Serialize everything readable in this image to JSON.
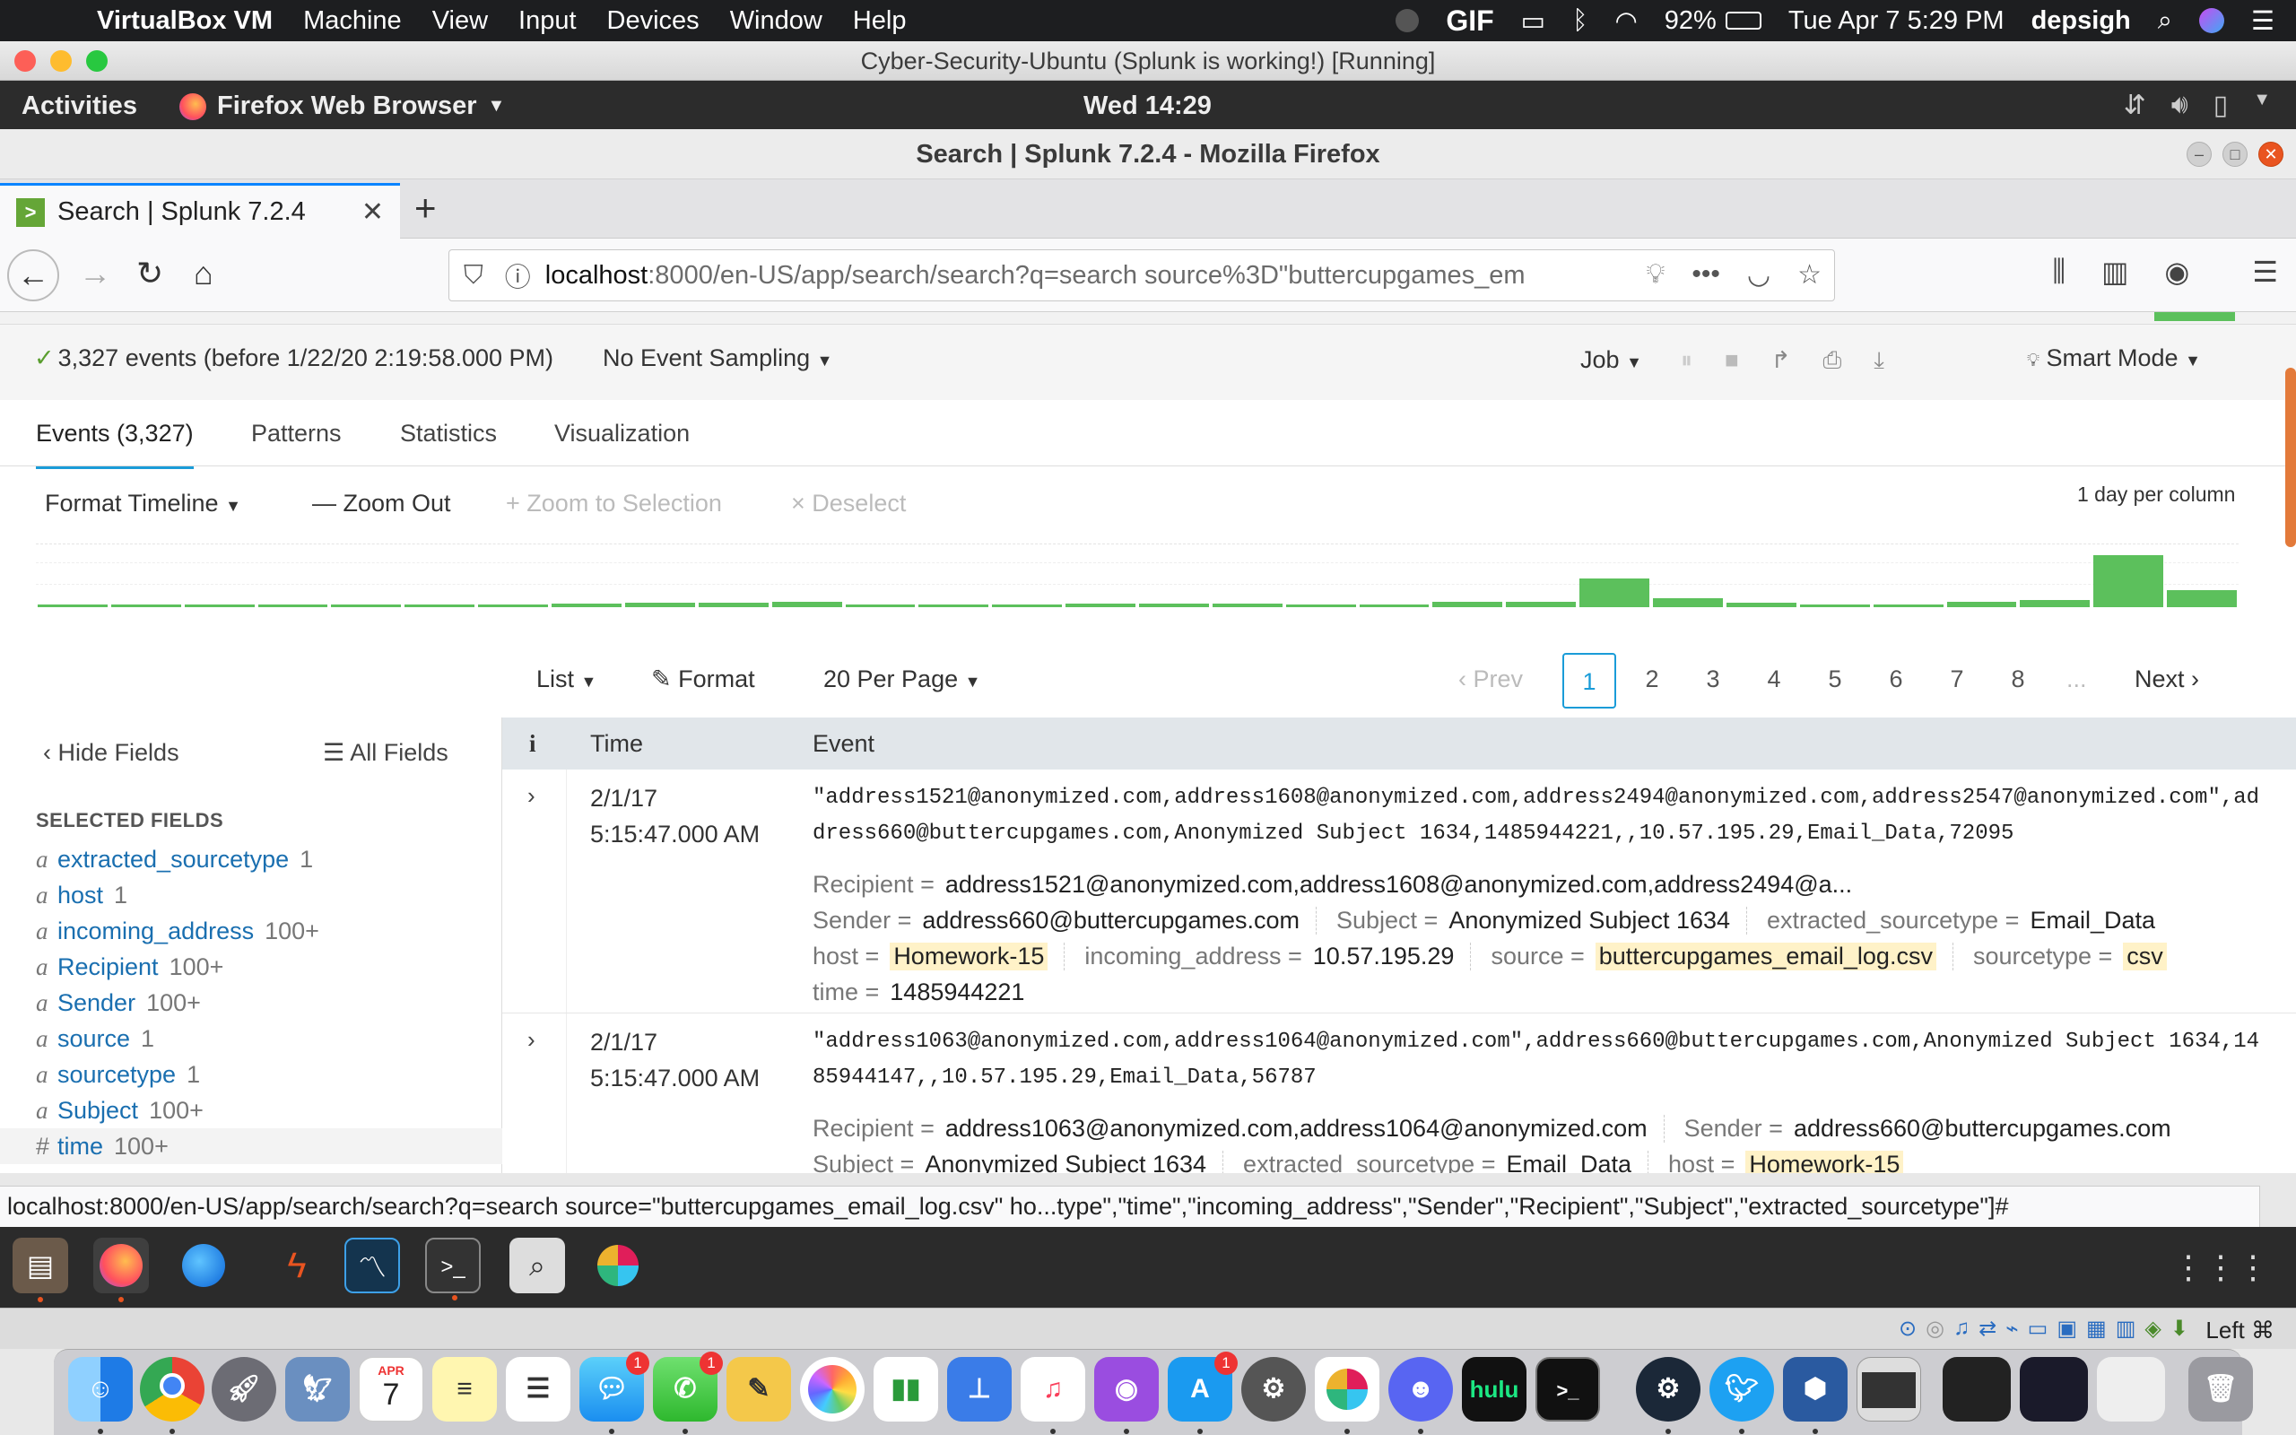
{
  "mac_menubar": {
    "app_name": "VirtualBox VM",
    "menus": [
      "Machine",
      "View",
      "Input",
      "Devices",
      "Window",
      "Help"
    ],
    "status": {
      "gif": "GIF",
      "battery": "92%",
      "datetime": "Tue Apr 7  5:29 PM",
      "user": "depsigh"
    }
  },
  "vbox_window": {
    "title": "Cyber-Security-Ubuntu (Splunk is working!) [Running]"
  },
  "ubuntu_topbar": {
    "activities": "Activities",
    "app": "Firefox Web Browser",
    "clock": "Wed 14:29"
  },
  "firefox": {
    "window_title": "Search | Splunk 7.2.4 - Mozilla Firefox",
    "tab_title": "Search | Splunk 7.2.4",
    "url_host": "localhost",
    "url_path": ":8000/en-US/app/search/search?q=search source%3D\"buttercupgames_em",
    "status_url": "localhost:8000/en-US/app/search/search?q=search source=\"buttercupgames_email_log.csv\" ho...type\",\"time\",\"incoming_address\",\"Sender\",\"Recipient\",\"Subject\",\"extracted_sourcetype\"]#"
  },
  "splunk": {
    "events_summary": "3,327 events (before 1/22/20 2:19:58.000 PM)",
    "sampling": "No Event Sampling",
    "job": "Job",
    "mode": "Smart Mode",
    "tabs": [
      "Events (3,327)",
      "Patterns",
      "Statistics",
      "Visualization"
    ],
    "timeline_controls": {
      "format": "Format Timeline",
      "zoom_out": "Zoom Out",
      "zoom_selection": "Zoom to Selection",
      "deselect": "Deselect",
      "scale": "1 day per column"
    },
    "timeline_counts": [
      0.02,
      0.05,
      0.05,
      0.05,
      0.05,
      0.05,
      0.05,
      0.06,
      0.08,
      0.08,
      0.1,
      0.05,
      0.05,
      0.05,
      0.07,
      0.07,
      0.07,
      0.05,
      0.04,
      0.1,
      0.1,
      0.5,
      0.15,
      0.08,
      0.05,
      0.05,
      0.1,
      0.12,
      0.9,
      0.3
    ],
    "list_options": {
      "list": "List",
      "format": "Format",
      "per_page": "20 Per Page"
    },
    "pagination": {
      "prev": "Prev",
      "pages": [
        "1",
        "2",
        "3",
        "4",
        "5",
        "6",
        "7",
        "8"
      ],
      "current": "1",
      "ellipsis": "...",
      "next": "Next"
    },
    "sidebar": {
      "hide_fields": "Hide Fields",
      "all_fields": "All Fields",
      "selected_heading": "SELECTED FIELDS",
      "fields": [
        {
          "type": "a",
          "name": "extracted_sourcetype",
          "count": "1"
        },
        {
          "type": "a",
          "name": "host",
          "count": "1"
        },
        {
          "type": "a",
          "name": "incoming_address",
          "count": "100+"
        },
        {
          "type": "a",
          "name": "Recipient",
          "count": "100+"
        },
        {
          "type": "a",
          "name": "Sender",
          "count": "100+"
        },
        {
          "type": "a",
          "name": "source",
          "count": "1"
        },
        {
          "type": "a",
          "name": "sourcetype",
          "count": "1"
        },
        {
          "type": "a",
          "name": "Subject",
          "count": "100+"
        },
        {
          "type": "#",
          "name": "time",
          "count": "100+"
        }
      ]
    },
    "table_headers": {
      "info": "i",
      "time": "Time",
      "event": "Event"
    },
    "events": [
      {
        "date": "2/1/17",
        "time": "5:15:47.000 AM",
        "raw": "\"address1521@anonymized.com,address1608@anonymized.com,address2494@anonymized.com,address2547@anonymized.com\",address660@buttercupgames.com,Anonymized Subject 1634,1485944221,,10.57.195.29,Email_Data,72095",
        "line1_k0": "Recipient =",
        "line1_v0": "address1521@anonymized.com,address1608@anonymized.com,address2494@a...",
        "line2_k0": "Sender =",
        "line2_v0": "address660@buttercupgames.com",
        "line2_k1": "Subject =",
        "line2_v1": "Anonymized Subject 1634",
        "line2_k2": "extracted_sourcetype =",
        "line2_v2": "Email_Data",
        "line3_k0": "host =",
        "line3_v0": "Homework-15",
        "line3_k1": "incoming_address =",
        "line3_v1": "10.57.195.29",
        "line3_k2": "source =",
        "line3_v2": "buttercupgames_email_log.csv",
        "line3_k3": "sourcetype =",
        "line3_v3": "csv",
        "line4_k0": "time =",
        "line4_v0": "1485944221"
      },
      {
        "date": "2/1/17",
        "time": "5:15:47.000 AM",
        "raw": "\"address1063@anonymized.com,address1064@anonymized.com\",address660@buttercupgames.com,Anonymized Subject 1634,1485944147,,10.57.195.29,Email_Data,56787",
        "line1_k0": "Recipient =",
        "line1_v0": "address1063@anonymized.com,address1064@anonymized.com",
        "line1_k1": "Sender =",
        "line1_v1": "address660@buttercupgames.com",
        "line2_k0": "Subject =",
        "line2_v0": "Anonymized Subject 1634",
        "line2_k1": "extracted_sourcetype =",
        "line2_v1": "Email_Data",
        "line2_k2": "host =",
        "line2_v2": "Homework-15"
      }
    ]
  },
  "vbox_status": {
    "hostkey": "Left ⌘"
  },
  "dock_badges": {
    "messages": "1",
    "facetime": "1",
    "appstore": "1"
  },
  "dock_labels": {
    "calendar_month": "APR",
    "calendar_day": "7",
    "hulu": "hulu"
  }
}
